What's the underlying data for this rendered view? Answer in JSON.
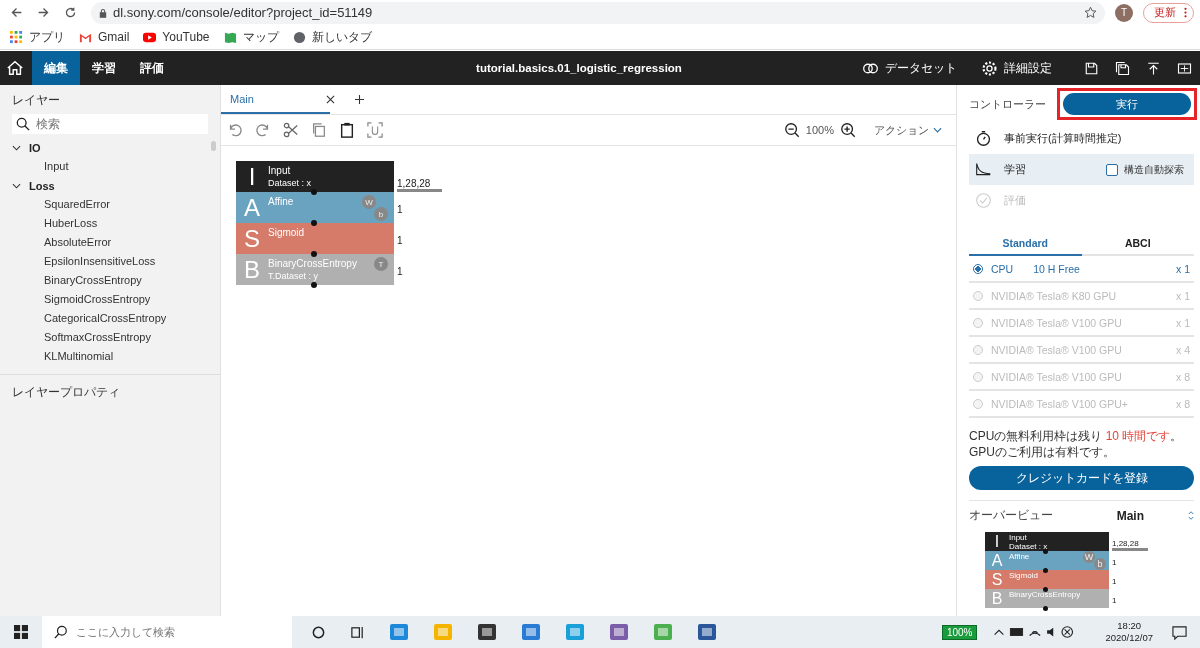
{
  "browser": {
    "url": "dl.sony.com/console/editor?project_id=51149",
    "avatar": "T",
    "update_button": "更新",
    "bookmarks": [
      {
        "kind": "apps",
        "label": "アプリ"
      },
      {
        "kind": "gmail",
        "label": "Gmail"
      },
      {
        "kind": "youtube",
        "label": "YouTube"
      },
      {
        "kind": "maps",
        "label": "マップ"
      },
      {
        "kind": "globe",
        "label": "新しいタブ"
      }
    ]
  },
  "header": {
    "title": "tutorial.basics.01_logistic_regression",
    "nav_tabs": [
      {
        "label": "編集",
        "selected": true
      },
      {
        "label": "学習",
        "selected": false
      },
      {
        "label": "評価",
        "selected": false
      }
    ],
    "actions": [
      {
        "kind": "dataset",
        "label": "データセット"
      },
      {
        "kind": "settings",
        "label": "詳細設定"
      }
    ]
  },
  "sidebar": {
    "title": "レイヤー",
    "search": {
      "placeholder": "検索"
    },
    "tree": [
      {
        "label": "IO",
        "expanded": true,
        "children": [
          {
            "label": "Input"
          }
        ]
      },
      {
        "label": "Loss",
        "expanded": true,
        "children": [
          {
            "label": "SquaredError"
          },
          {
            "label": "HuberLoss"
          },
          {
            "label": "AbsoluteError"
          },
          {
            "label": "EpsilonInsensitiveLoss"
          },
          {
            "label": "BinaryCrossEntropy"
          },
          {
            "label": "SigmoidCrossEntropy"
          },
          {
            "label": "CategoricalCrossEntropy"
          },
          {
            "label": "SoftmaxCrossEntropy"
          },
          {
            "label": "KLMultinomial"
          }
        ]
      }
    ],
    "properties_title": "レイヤープロパティ"
  },
  "editor": {
    "tabs": [
      {
        "label": "Main",
        "selected": true
      }
    ],
    "zoom": "100%",
    "action_menu": "アクション",
    "layers": [
      {
        "letter": "I",
        "name": "Input",
        "sub": "Dataset : x",
        "color": "#222222",
        "output": "1,28,28"
      },
      {
        "letter": "A",
        "name": "Affine",
        "color": "#6aa3c0",
        "badges": [
          "W",
          "b"
        ],
        "output": "1"
      },
      {
        "letter": "S",
        "name": "Sigmoid",
        "color": "#d67a6a",
        "output": "1"
      },
      {
        "letter": "B",
        "name": "BinaryCrossEntropy",
        "sub": "T.Dataset : y",
        "color": "#b0b0b0",
        "badges": [
          "T"
        ],
        "output": "1"
      }
    ]
  },
  "controller": {
    "title": "コントローラー",
    "run_button": "実行",
    "steps": [
      {
        "kind": "profile",
        "label": "事前実行(計算時間推定)",
        "selected": false,
        "disabled": false
      },
      {
        "kind": "train",
        "label": "学習",
        "selected": true,
        "disabled": false,
        "option": {
          "label": "構造自動探索",
          "checked": false
        }
      },
      {
        "kind": "eval",
        "label": "評価",
        "selected": false,
        "disabled": true
      }
    ],
    "tabs": [
      {
        "label": "Standard",
        "selected": true
      },
      {
        "label": "ABCI",
        "selected": false
      }
    ],
    "instances": [
      {
        "name": "CPU",
        "note": "10 H Free",
        "count": "x 1",
        "selected": true,
        "disabled": false
      },
      {
        "name": "NVIDIA® Tesla® K80 GPU",
        "count": "x 1",
        "selected": false,
        "disabled": true
      },
      {
        "name": "NVIDIA® Tesla® V100 GPU",
        "count": "x 1",
        "selected": false,
        "disabled": true
      },
      {
        "name": "NVIDIA® Tesla® V100 GPU",
        "count": "x 4",
        "selected": false,
        "disabled": true
      },
      {
        "name": "NVIDIA® Tesla® V100 GPU",
        "count": "x 8",
        "selected": false,
        "disabled": true
      },
      {
        "name": "NVIDIA® Tesla® V100 GPU+",
        "count": "x 8",
        "selected": false,
        "disabled": true
      }
    ],
    "notice": {
      "before": "CPUの無料利用枠は残り ",
      "highlight": "10 時間です",
      "after": "。 GPUのご利用は有料です。"
    },
    "credit_button": "クレジットカードを登録"
  },
  "overview": {
    "title": "オーバービュー",
    "graph": "Main",
    "layers": [
      {
        "letter": "I",
        "name": "Input",
        "sub": "Dataset : x",
        "color": "#222222",
        "output": "1,28,28"
      },
      {
        "letter": "A",
        "name": "Affine",
        "color": "#6aa3c0",
        "badges": [
          "W",
          "b"
        ],
        "output": "1"
      },
      {
        "letter": "S",
        "name": "Sigmoid",
        "color": "#d67a6a",
        "output": "1"
      },
      {
        "letter": "B",
        "name": "BinaryCrossEntropy",
        "color": "#b0b0b0",
        "output": "1"
      }
    ]
  },
  "taskbar": {
    "search": {
      "placeholder": "ここに入力して検索"
    },
    "battery": "100%",
    "time": "18:20",
    "date": "2020/12/07"
  }
}
